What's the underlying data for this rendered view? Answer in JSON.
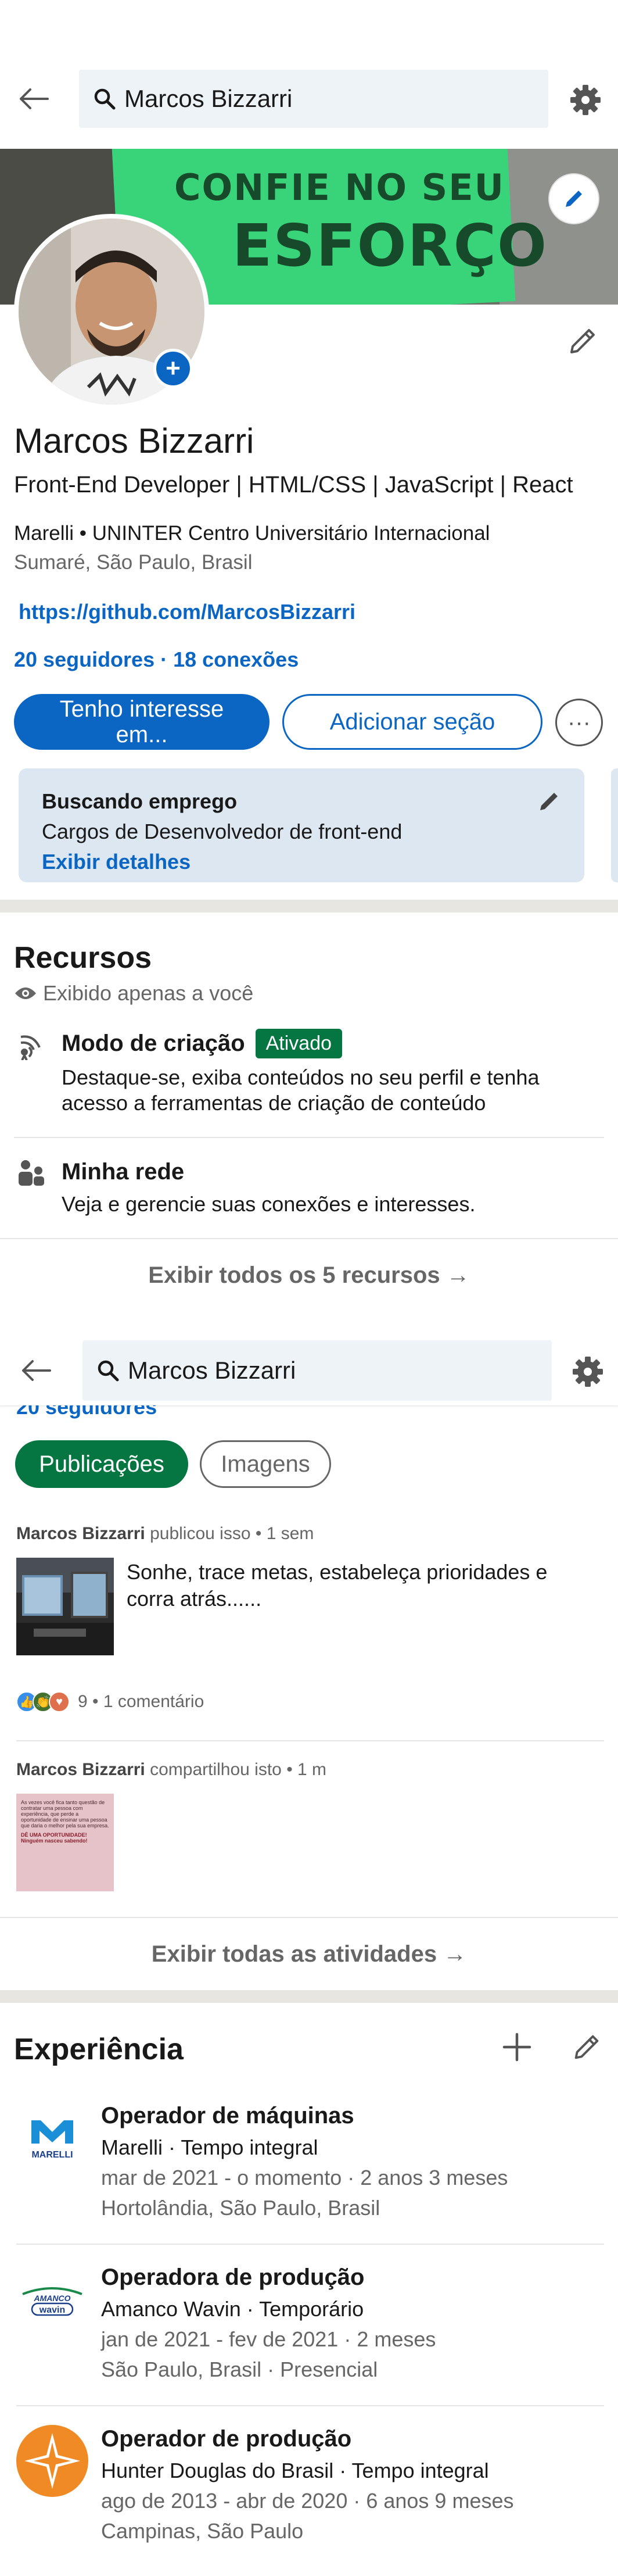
{
  "search": {
    "query": "Marcos Bizzarri"
  },
  "profile": {
    "name": "Marcos Bizzarri",
    "headline": "Front-End Developer | HTML/CSS  | JavaScript | React",
    "education": "Marelli • UNINTER Centro Universitário Internacional",
    "location": "Sumaré, São Paulo, Brasil",
    "link": "https://github.com/MarcosBizzarri",
    "counts": "20 seguidores · 18 conexões",
    "banner_text_1": "CONFIE NO SEU",
    "banner_text_2": "ESFORÇO",
    "avatar_plus": "+"
  },
  "actions": {
    "primary_line1": "Tenho interesse",
    "primary_line2": "em...",
    "secondary": "Adicionar seção",
    "more": "···"
  },
  "job_card": {
    "title": "Buscando emprego",
    "desc": "Cargos de Desenvolvedor de front-end",
    "link": "Exibir detalhes"
  },
  "resources": {
    "title": "Recursos",
    "private": "Exibido apenas a você",
    "items": [
      {
        "title": "Modo de criação",
        "badge": "Ativado",
        "desc": "Destaque-se, exiba conteúdos no seu perfil e tenha acesso a ferramentas de criação de conteúdo",
        "icon": "broadcast-icon"
      },
      {
        "title": "Minha rede",
        "desc": "Veja e gerencie suas conexões e interesses.",
        "icon": "people-icon"
      }
    ],
    "show_all": "Exibir todos os 5 recursos"
  },
  "activity": {
    "cut_followers": "20 seguidores",
    "tabs": [
      "Publicações",
      "Imagens"
    ],
    "posts": [
      {
        "author": "Marcos Bizzarri",
        "meta": " publicou isso • 1 sem",
        "text": "Sonhe, trace metas, estabeleça prioridades e corra atrás......",
        "reactions": "9 • 1 comentário"
      },
      {
        "author": "Marcos Bizzarri",
        "meta": " compartilhou isto • 1 m",
        "img_text_1": "As vezes você fica tanto questão de contratar uma pessoa com experiência, que perde a oportunidade de ensinar uma pessoa que daria o melhor pela sua empresa.",
        "img_text_2": "DÊ UMA OPORTUNIDADE! Ninguém nasceu sabendo!"
      }
    ],
    "show_all": "Exibir todas as atividades"
  },
  "experience": {
    "title": "Experiência",
    "items": [
      {
        "role": "Operador de máquinas",
        "company": "Marelli · Tempo integral",
        "period": "mar de 2021 - o momento · 2 anos 3 meses",
        "place": "Hortolândia, São Paulo, Brasil",
        "logo_text": "MARELLI"
      },
      {
        "role": "Operadora de produção",
        "company": "Amanco Wavin · Temporário",
        "period": "jan de 2021 - fev de 2021 · 2 meses",
        "place": "São Paulo, Brasil · Presencial",
        "logo_text": "AMANCO",
        "logo_text_2": "wavin"
      },
      {
        "role": "Operador de produção",
        "company": "Hunter Douglas do Brasil · Tempo integral",
        "period": "ago de 2013 - abr de 2020 · 6 anos 9 meses",
        "place": "Campinas, São Paulo"
      }
    ]
  },
  "colors": {
    "brand": "#0a66c2",
    "green": "#057642",
    "divider": "#e8e6e1"
  }
}
